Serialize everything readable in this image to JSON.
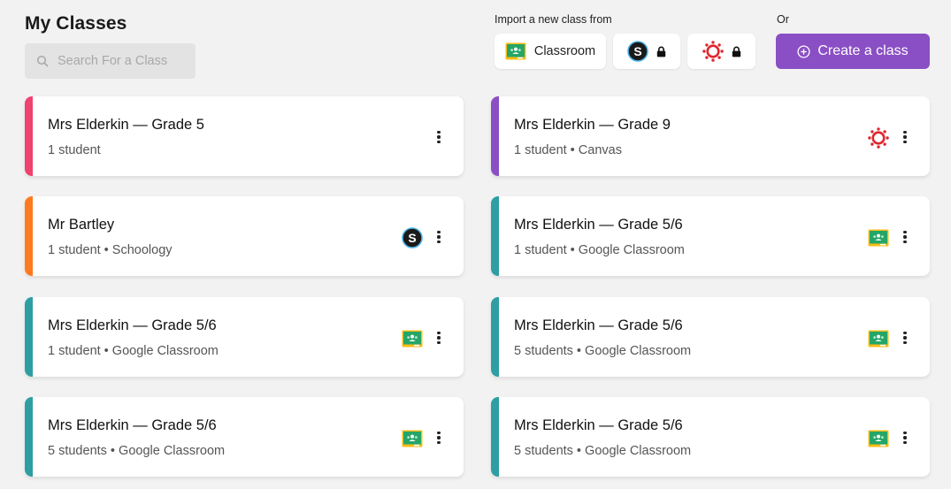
{
  "header": {
    "title": "My Classes",
    "search_placeholder": "Search For a Class"
  },
  "import": {
    "label": "Import a new class from",
    "classroom_label": "Classroom",
    "or_label": "Or",
    "create_label": "Create a class"
  },
  "colors": {
    "purple": "#8a4fc4",
    "pink": "#f0426f",
    "orange": "#ff7a1f",
    "teal": "#2e9ea3",
    "violet": "#8a4fc4"
  },
  "classes_left": [
    {
      "title": "Mrs Elderkin — Grade 5",
      "subtitle": "1 student",
      "provider": "none"
    },
    {
      "title": "Mr Bartley",
      "subtitle": "1 student • Schoology",
      "provider": "schoology-icon"
    },
    {
      "title": "Mrs Elderkin — Grade 5/6",
      "subtitle": "1 student • Google Classroom",
      "provider": "google-classroom-icon"
    },
    {
      "title": "Mrs Elderkin — Grade 5/6",
      "subtitle": "5 students • Google Classroom",
      "provider": "google-classroom-icon"
    }
  ],
  "classes_right": [
    {
      "title": "Mrs Elderkin — Grade 9",
      "subtitle": "1 student • Canvas",
      "provider": "canvas-icon"
    },
    {
      "title": "Mrs Elderkin — Grade 5/6",
      "subtitle": "1 student • Google Classroom",
      "provider": "google-classroom-icon"
    },
    {
      "title": "Mrs Elderkin — Grade 5/6",
      "subtitle": "5 students • Google Classroom",
      "provider": "google-classroom-icon"
    },
    {
      "title": "Mrs Elderkin — Grade 5/6",
      "subtitle": "5 students • Google Classroom",
      "provider": "google-classroom-icon"
    }
  ]
}
